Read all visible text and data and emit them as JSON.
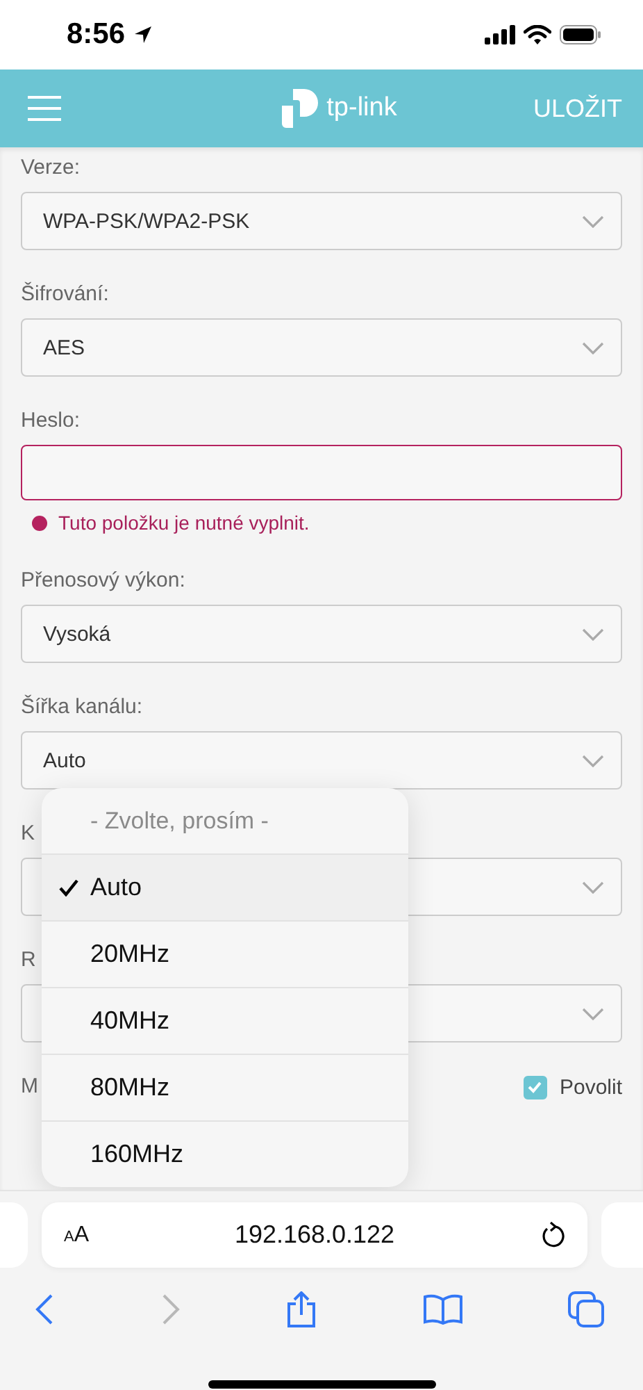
{
  "status_bar": {
    "time": "8:56"
  },
  "header": {
    "logo": "tp-link",
    "action": "ULOŽIT"
  },
  "fields": [
    {
      "kind": "select",
      "label": "Verze:",
      "value": "WPA-PSK/WPA2-PSK"
    },
    {
      "kind": "select",
      "label": "Šifrování:",
      "value": "AES"
    },
    {
      "kind": "input",
      "label": "Heslo:",
      "invalid": true,
      "error": "Tuto položku je nutné vyplnit."
    },
    {
      "kind": "select",
      "label": "Přenosový výkon:",
      "value": "Vysoká"
    },
    {
      "kind": "select",
      "label": "Šířka kanálu:",
      "value": "Auto"
    },
    {
      "kind": "select",
      "label": "K"
    },
    {
      "kind": "select",
      "label": "R"
    },
    {
      "kind": "checkbox",
      "label": "M",
      "checked": true,
      "option": "Povolit"
    }
  ],
  "dropdown": {
    "placeholder": "- Zvolte, prosím -",
    "options": [
      {
        "label": "Auto",
        "selected": true
      },
      {
        "label": "20MHz",
        "selected": false
      },
      {
        "label": "40MHz",
        "selected": false
      },
      {
        "label": "80MHz",
        "selected": false
      },
      {
        "label": "160MHz",
        "selected": false
      }
    ]
  },
  "browser": {
    "text_size": "AA",
    "url": "192.168.0.122",
    "forward_disabled": true
  }
}
